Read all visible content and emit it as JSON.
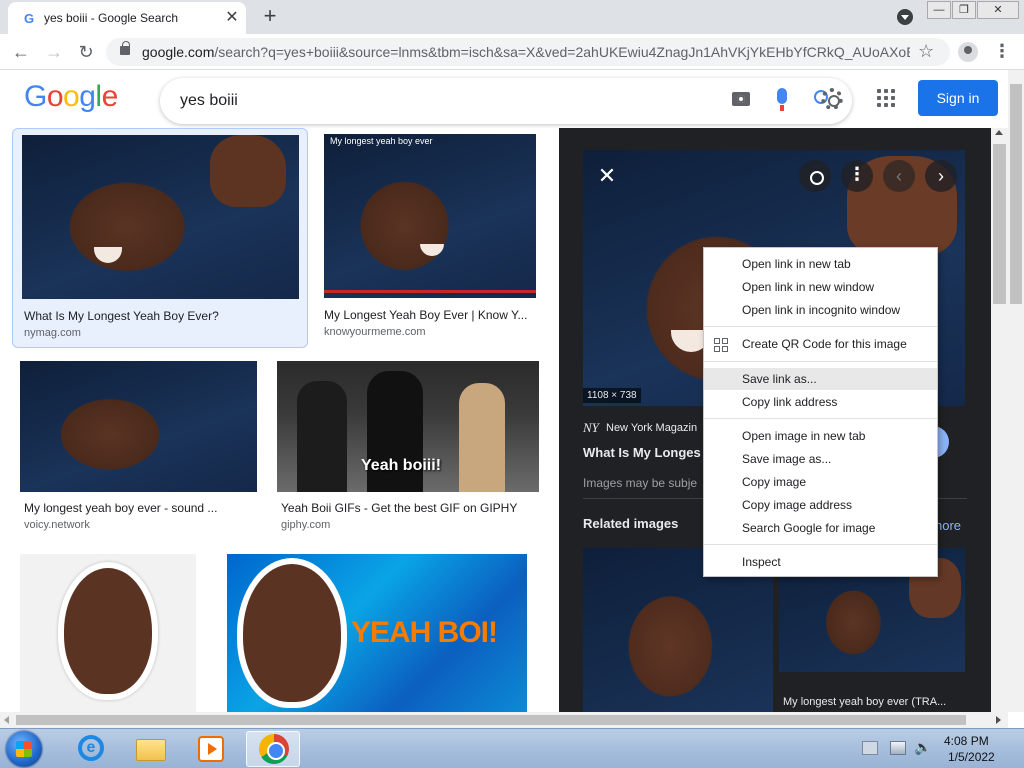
{
  "browser": {
    "tab_title": "yes boiii - Google Search",
    "tab_favicon": "G",
    "url_host": "google.com",
    "url_path": "/search?q=yes+boiii&source=lnms&tbm=isch&sa=X&ved=2ahUKEwiu4ZnagJn1AhVKjYkEHbYfCRkQ_AUoAXoE...",
    "window_buttons": [
      "—",
      "❐",
      "✕"
    ]
  },
  "google": {
    "logo_letters": [
      "G",
      "o",
      "o",
      "g",
      "l",
      "e"
    ],
    "logo_colors": [
      "#4285f4",
      "#ea4335",
      "#fbbc05",
      "#4285f4",
      "#34a853",
      "#ea4335"
    ],
    "query": "yes boiii",
    "signin_label": "Sign in"
  },
  "results": [
    {
      "caption": "What Is My Longest Yeah Boy Ever?",
      "source": "nymag.com"
    },
    {
      "caption": "My Longest Yeah Boy Ever | Know Y...",
      "source": "knowyourmeme.com",
      "overlay_text": "My longest yeah boy ever"
    },
    {
      "caption": "My longest yeah boy ever - sound ...",
      "source": "voicy.network"
    },
    {
      "caption": "Yeah Boii GIFs - Get the best GIF on GIPHY",
      "source": "giphy.com",
      "overlay_text": "Yeah boiii!"
    },
    {
      "caption": "",
      "source": ""
    },
    {
      "caption": "",
      "source": "",
      "overlay_text": "YEAH BOI!"
    }
  ],
  "preview": {
    "dimensions": "1108 × 738",
    "source_name": "New York Magazin",
    "source_logo": "NY",
    "title": "What Is My Longes",
    "note": "Images may be subje",
    "related_label": "Related images",
    "see_more_label": "nore",
    "related_caption": "My longest yeah boy ever (TRA..."
  },
  "context_menu": {
    "groups": [
      [
        "Open link in new tab",
        "Open link in new window",
        "Open link in incognito window"
      ],
      [
        "Create QR Code for this image"
      ],
      [
        "Save link as...",
        "Copy link address"
      ],
      [
        "Open image in new tab",
        "Save image as...",
        "Copy image",
        "Copy image address",
        "Search Google for image"
      ],
      [
        "Inspect"
      ]
    ],
    "highlighted": "Save link as..."
  },
  "taskbar": {
    "time": "4:08 PM",
    "date": "1/5/2022"
  }
}
